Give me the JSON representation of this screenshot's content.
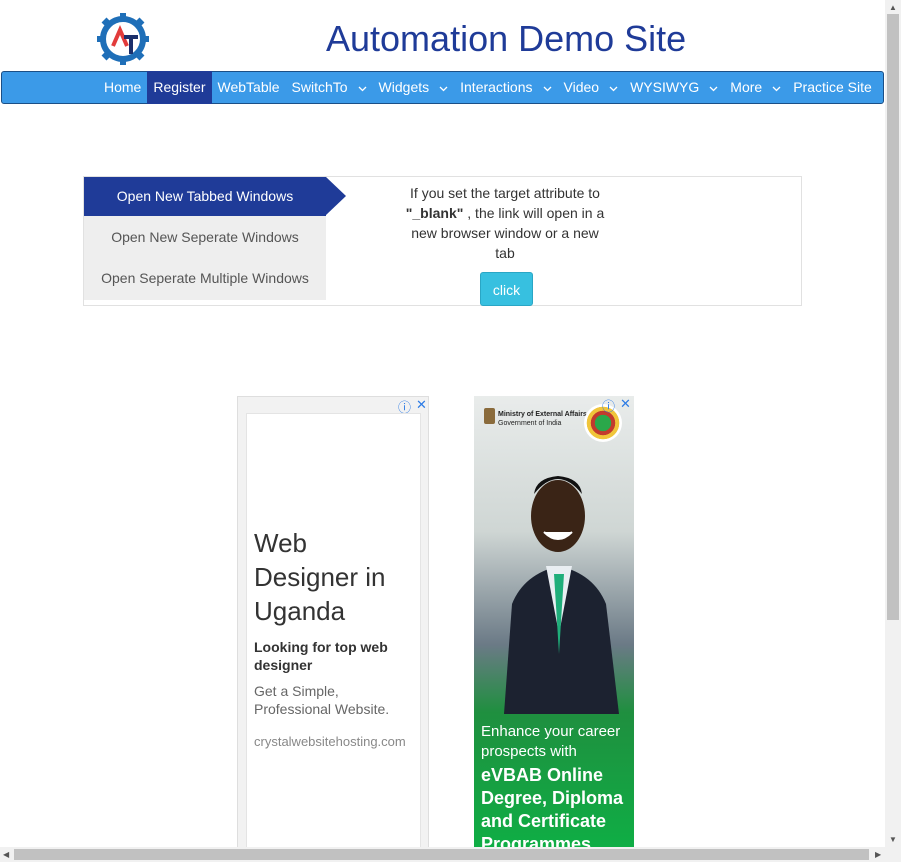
{
  "site": {
    "title": "Automation Demo Site"
  },
  "nav": {
    "items": [
      {
        "label": "Home",
        "active": false,
        "dropdown": false
      },
      {
        "label": "Register",
        "active": true,
        "dropdown": false
      },
      {
        "label": "WebTable",
        "active": false,
        "dropdown": false
      },
      {
        "label": "SwitchTo",
        "active": false,
        "dropdown": true
      },
      {
        "label": "Widgets",
        "active": false,
        "dropdown": true
      },
      {
        "label": "Interactions",
        "active": false,
        "dropdown": true
      },
      {
        "label": "Video",
        "active": false,
        "dropdown": true
      },
      {
        "label": "WYSIWYG",
        "active": false,
        "dropdown": true
      },
      {
        "label": "More",
        "active": false,
        "dropdown": true
      },
      {
        "label": "Practice Site",
        "active": false,
        "dropdown": false
      }
    ]
  },
  "panel": {
    "tabs": [
      {
        "label": "Open New Tabbed Windows",
        "active": true
      },
      {
        "label": "Open New Seperate Windows",
        "active": false
      },
      {
        "label": "Open Seperate Multiple Windows",
        "active": false
      }
    ],
    "description_pre": "If you set the target attribute to",
    "description_bold": "\"_blank\"",
    "description_post": ", the link will open in a new browser window or a new tab",
    "button_label": "click"
  },
  "ad1": {
    "headline": "Web Designer in Uganda",
    "subheadline": "Looking for top web designer",
    "body": "Get a Simple, Professional Website.",
    "url": "crystalwebsitehosting.com"
  },
  "ad2": {
    "ministry_line1": "Ministry of External Affairs",
    "ministry_line2": "Government of India",
    "text1": "Enhance your career prospects with",
    "text2": "eVBAB Online Degree, Diploma and Certificate Programmes"
  },
  "ad_controls": {
    "info": "ⓘ",
    "close": "✕"
  },
  "colors": {
    "navbar": "#3b9ae8",
    "nav_active": "#1f3b98",
    "title": "#1f3b98",
    "button": "#37c0e0"
  },
  "icons": {
    "logo": "automation-testing-gear-logo",
    "dropdown": "chevron-down-icon"
  }
}
